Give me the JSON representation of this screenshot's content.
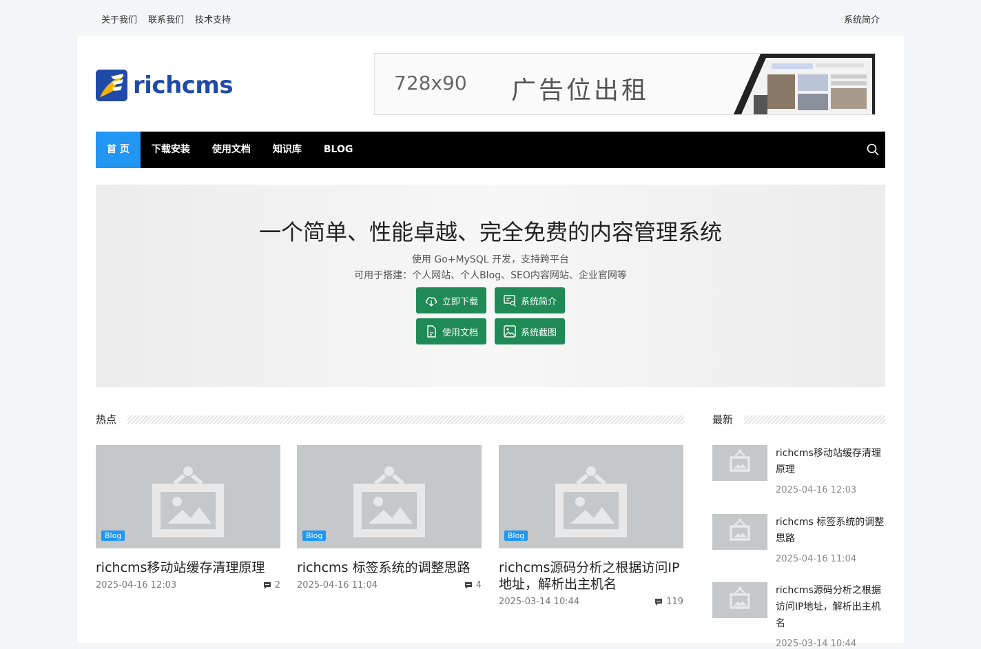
{
  "topbar": {
    "links": [
      "关于我们",
      "联系我们",
      "技术支持"
    ],
    "right_link": "系统简介"
  },
  "logo": {
    "text": "richcms"
  },
  "ad": {
    "size_text": "728x90",
    "slogan": "广告位出租"
  },
  "nav": {
    "items": [
      "首 页",
      "下载安装",
      "使用文档",
      "知识库",
      "BLOG"
    ],
    "active_index": 0
  },
  "hero": {
    "title": "一个简单、性能卓越、完全免费的内容管理系统",
    "subtitle_1": "使用 Go+MySQL 开发，支持跨平台",
    "subtitle_2": "可用于搭建：个人网站、个人Blog、SEO内容网站、企业官网等",
    "buttons": [
      "立即下载",
      "系统简介",
      "使用文档",
      "系统截图"
    ]
  },
  "hot": {
    "title": "热点",
    "posts": [
      {
        "tag": "Blog",
        "title": "richcms移动站缓存清理原理",
        "date": "2025-04-16 12:03",
        "comments": "2"
      },
      {
        "tag": "Blog",
        "title": "richcms 标签系统的调整思路",
        "date": "2025-04-16 11:04",
        "comments": "4"
      },
      {
        "tag": "Blog",
        "title": "richcms源码分析之根据访问IP地址，解析出主机名",
        "date": "2025-03-14 10:44",
        "comments": "119"
      }
    ]
  },
  "latest": {
    "title": "最新",
    "posts": [
      {
        "title": "richcms移动站缓存清理原理",
        "date": "2025-04-16 12:03"
      },
      {
        "title": "richcms 标签系统的调整思路",
        "date": "2025-04-16 11:04"
      },
      {
        "title": "richcms源码分析之根据访问IP地址，解析出主机名",
        "date": "2025-03-14 10:44"
      }
    ]
  },
  "colors": {
    "nav_active": "#2196f3",
    "button_green": "#1f8a55",
    "brand_blue": "#1f4aa8"
  }
}
